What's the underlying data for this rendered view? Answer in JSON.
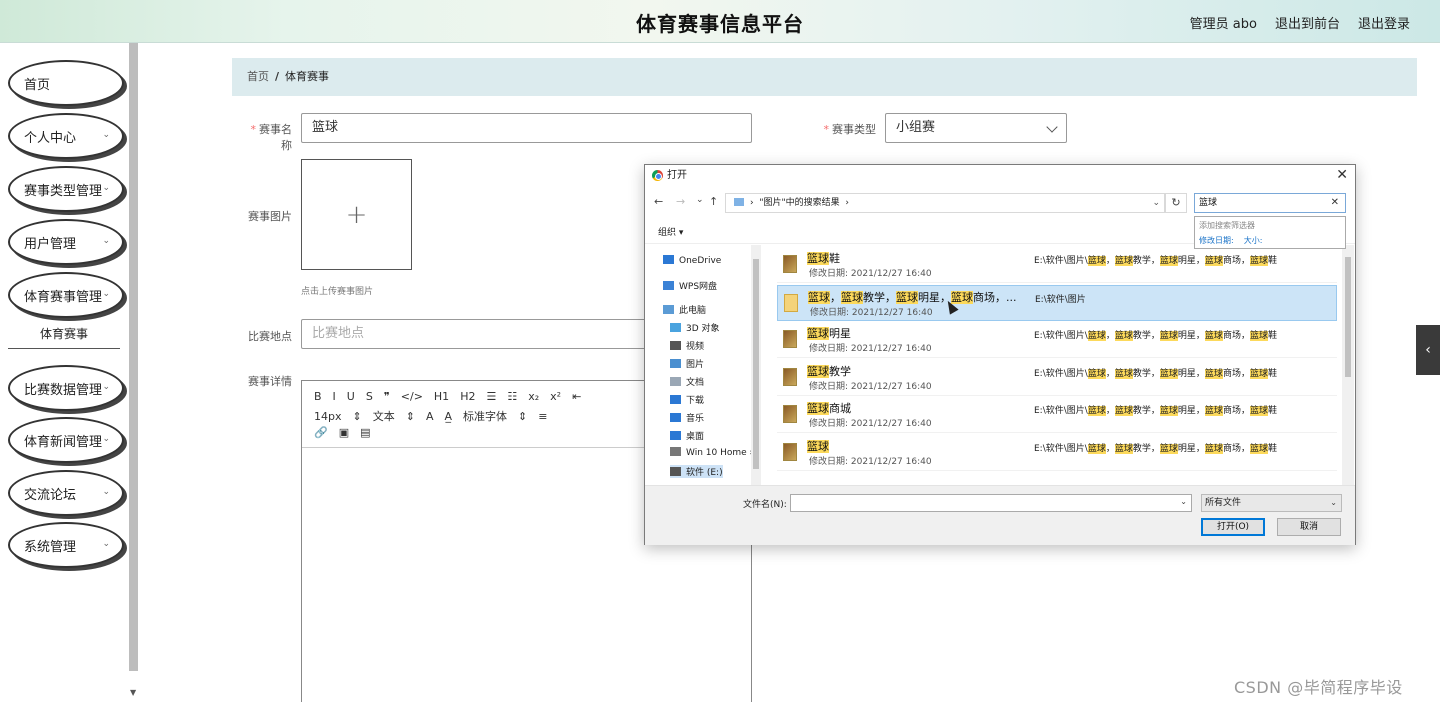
{
  "header": {
    "title": "体育赛事信息平台",
    "admin": "管理员 abo",
    "to_front": "退出到前台",
    "logout": "退出登录"
  },
  "sidebar": {
    "items": [
      {
        "label": "首页",
        "chevron": false
      },
      {
        "label": "个人中心",
        "chevron": true
      },
      {
        "label": "赛事类型管理",
        "chevron": true
      },
      {
        "label": "用户管理",
        "chevron": true
      },
      {
        "label": "体育赛事管理",
        "chevron": true
      },
      {
        "label": "比赛数据管理",
        "chevron": true
      },
      {
        "label": "体育新闻管理",
        "chevron": true
      },
      {
        "label": "交流论坛",
        "chevron": true
      },
      {
        "label": "系统管理",
        "chevron": true
      }
    ],
    "sub_item": "体育赛事"
  },
  "breadcrumb": {
    "home": "首页",
    "sep": "/",
    "current": "体育赛事"
  },
  "form": {
    "name_label": "赛事名称",
    "name_value": "篮球",
    "type_label": "赛事类型",
    "type_value": "小组赛",
    "image_label": "赛事图片",
    "upload_plus": "+",
    "upload_tip": "点击上传赛事图片",
    "place_label": "比赛地点",
    "place_placeholder": "比赛地点",
    "detail_label": "赛事详情",
    "required_mark": "*"
  },
  "editor": {
    "toolbar_row1": [
      "B",
      "I",
      "U",
      "S",
      "❞",
      "</>",
      "H1",
      "H2",
      "☰",
      "☷",
      "x₂",
      "x²",
      "⇤"
    ],
    "toolbar_row2": [
      "14px",
      "⇕",
      "文本",
      "⇕",
      "A",
      "A̲",
      "标准字体",
      "⇕",
      "≡"
    ],
    "toolbar_row3": [
      "🔗",
      "▣",
      "▤"
    ]
  },
  "side_tab": "‹",
  "watermark": "CSDN @毕简程序毕设",
  "dialog": {
    "title": "打开",
    "close": "✕",
    "nav": {
      "back": "←",
      "forward": "→",
      "recent": "⌄",
      "up": "↑"
    },
    "address": "\"图片\"中的搜索结果",
    "address_chevron": "›",
    "refresh": "↻",
    "search_value": "篮球",
    "search_clear": "✕",
    "suggest_header": "添加搜索筛选器",
    "suggest_filters": [
      "修改日期:",
      "大小:"
    ],
    "organize": "组织 ▾",
    "tree": [
      {
        "label": "OneDrive",
        "icon": "cloud-icon",
        "color": "#2b78d4"
      },
      {
        "label": "WPS网盘",
        "icon": "cloud-icon",
        "color": "#3b82d6"
      },
      {
        "label": "此电脑",
        "icon": "computer-icon",
        "color": "#5b9bd5"
      },
      {
        "label": "3D 对象",
        "icon": "cube-icon",
        "color": "#4aa3df"
      },
      {
        "label": "视频",
        "icon": "film-icon",
        "color": "#555555"
      },
      {
        "label": "图片",
        "icon": "picture-icon",
        "color": "#4a8fd0"
      },
      {
        "label": "文档",
        "icon": "document-icon",
        "color": "#9aa7b5"
      },
      {
        "label": "下载",
        "icon": "download-icon",
        "color": "#2b78d4"
      },
      {
        "label": "音乐",
        "icon": "music-icon",
        "color": "#2b78d4"
      },
      {
        "label": "桌面",
        "icon": "desktop-icon",
        "color": "#2b78d4"
      },
      {
        "label": "Win 10 Home ›",
        "icon": "drive-icon",
        "color": "#777777"
      },
      {
        "label": "软件 (E:)",
        "icon": "drive-icon",
        "color": "#555555"
      }
    ],
    "files": [
      {
        "name_parts": [
          [
            "篮球",
            true
          ],
          [
            "鞋",
            false
          ]
        ],
        "date": "修改日期: 2021/12/27 16:40",
        "path_parts": [
          [
            "E:\\软件\\图片\\",
            false
          ],
          [
            "篮球",
            true
          ],
          [
            "，",
            false
          ],
          [
            "篮球",
            true
          ],
          [
            "教学，",
            false
          ],
          [
            "篮球",
            true
          ],
          [
            "明星，",
            false
          ],
          [
            "篮球",
            true
          ],
          [
            "商场，",
            false
          ],
          [
            "篮球",
            true
          ],
          [
            "鞋",
            false
          ]
        ],
        "folder": false
      },
      {
        "name_parts": [
          [
            "篮球",
            true
          ],
          [
            "，",
            false
          ],
          [
            "篮球",
            true
          ],
          [
            "教学，",
            false
          ],
          [
            "篮球",
            true
          ],
          [
            "明星，",
            false
          ],
          [
            "篮球",
            true
          ],
          [
            "商场，...",
            false
          ]
        ],
        "date": "修改日期: 2021/12/27 16:40",
        "path_parts": [
          [
            "E:\\软件\\图片",
            false
          ]
        ],
        "folder": true
      },
      {
        "name_parts": [
          [
            "篮球",
            true
          ],
          [
            "明星",
            false
          ]
        ],
        "date": "修改日期: 2021/12/27 16:40",
        "path_parts": [
          [
            "E:\\软件\\图片\\",
            false
          ],
          [
            "篮球",
            true
          ],
          [
            "，",
            false
          ],
          [
            "篮球",
            true
          ],
          [
            "教学，",
            false
          ],
          [
            "篮球",
            true
          ],
          [
            "明星，",
            false
          ],
          [
            "篮球",
            true
          ],
          [
            "商场，",
            false
          ],
          [
            "篮球",
            true
          ],
          [
            "鞋",
            false
          ]
        ],
        "folder": false
      },
      {
        "name_parts": [
          [
            "篮球",
            true
          ],
          [
            "教学",
            false
          ]
        ],
        "date": "修改日期: 2021/12/27 16:40",
        "path_parts": [
          [
            "E:\\软件\\图片\\",
            false
          ],
          [
            "篮球",
            true
          ],
          [
            "，",
            false
          ],
          [
            "篮球",
            true
          ],
          [
            "教学，",
            false
          ],
          [
            "篮球",
            true
          ],
          [
            "明星，",
            false
          ],
          [
            "篮球",
            true
          ],
          [
            "商场，",
            false
          ],
          [
            "篮球",
            true
          ],
          [
            "鞋",
            false
          ]
        ],
        "folder": false
      },
      {
        "name_parts": [
          [
            "篮球",
            true
          ],
          [
            "商城",
            false
          ]
        ],
        "date": "修改日期: 2021/12/27 16:40",
        "path_parts": [
          [
            "E:\\软件\\图片\\",
            false
          ],
          [
            "篮球",
            true
          ],
          [
            "，",
            false
          ],
          [
            "篮球",
            true
          ],
          [
            "教学，",
            false
          ],
          [
            "篮球",
            true
          ],
          [
            "明星，",
            false
          ],
          [
            "篮球",
            true
          ],
          [
            "商场，",
            false
          ],
          [
            "篮球",
            true
          ],
          [
            "鞋",
            false
          ]
        ],
        "folder": false
      },
      {
        "name_parts": [
          [
            "篮球",
            true
          ]
        ],
        "date": "修改日期: 2021/12/27 16:40",
        "path_parts": [
          [
            "E:\\软件\\图片\\",
            false
          ],
          [
            "篮球",
            true
          ],
          [
            "，",
            false
          ],
          [
            "篮球",
            true
          ],
          [
            "教学，",
            false
          ],
          [
            "篮球",
            true
          ],
          [
            "明星，",
            false
          ],
          [
            "篮球",
            true
          ],
          [
            "商场，",
            false
          ],
          [
            "篮球",
            true
          ],
          [
            "鞋",
            false
          ]
        ],
        "folder": false
      }
    ],
    "filename_label": "文件名(N):",
    "filetype": "所有文件",
    "open_button": "打开(O)",
    "cancel_button": "取消"
  }
}
